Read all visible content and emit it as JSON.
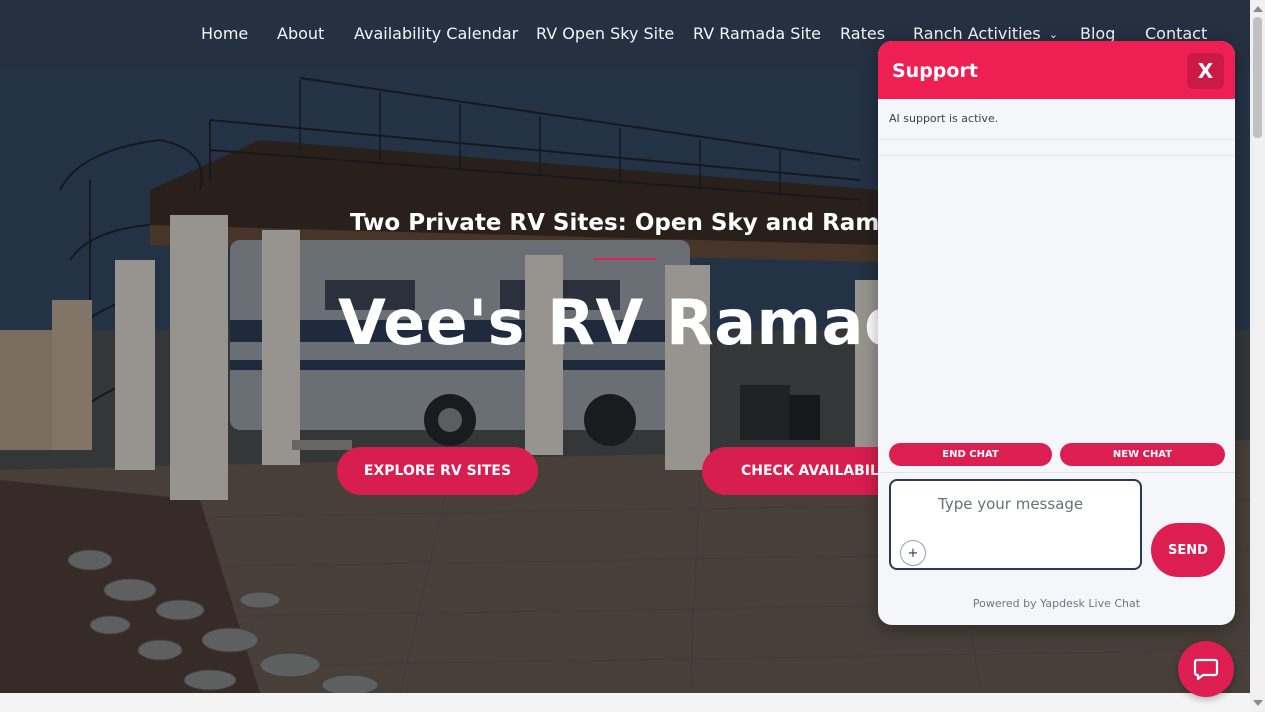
{
  "nav": {
    "items": [
      {
        "label": "Home"
      },
      {
        "label": "About"
      },
      {
        "label": "Availability Calendar"
      },
      {
        "label": "RV Open Sky Site"
      },
      {
        "label": "RV Ramada Site"
      },
      {
        "label": "Rates"
      },
      {
        "label": "Ranch Activities",
        "has_dropdown": true
      },
      {
        "label": "Blog"
      },
      {
        "label": "Contact"
      }
    ]
  },
  "hero": {
    "subtitle": "Two Private RV Sites: Open Sky and Ramada",
    "title": "Vee's RV Ramada",
    "buttons": {
      "explore": "EXPLORE RV SITES",
      "check": "CHECK AVAILABILITY"
    }
  },
  "chat": {
    "title": "Support",
    "close_label": "X",
    "status": "AI support is active.",
    "end_chat": "END CHAT",
    "new_chat": "NEW CHAT",
    "input_placeholder": "Type your message",
    "attach_label": "+",
    "send": "SEND",
    "powered_by": "Powered by Yapdesk Live Chat"
  },
  "colors": {
    "nav_bg": "#253041",
    "accent": "#dc1f50",
    "chat_header": "#ee1f52",
    "chat_bg": "#f5f6fa"
  },
  "icons": {
    "chevron": "chevron-down-icon",
    "attach": "plus-icon",
    "launcher": "chat-bubble-icon"
  }
}
